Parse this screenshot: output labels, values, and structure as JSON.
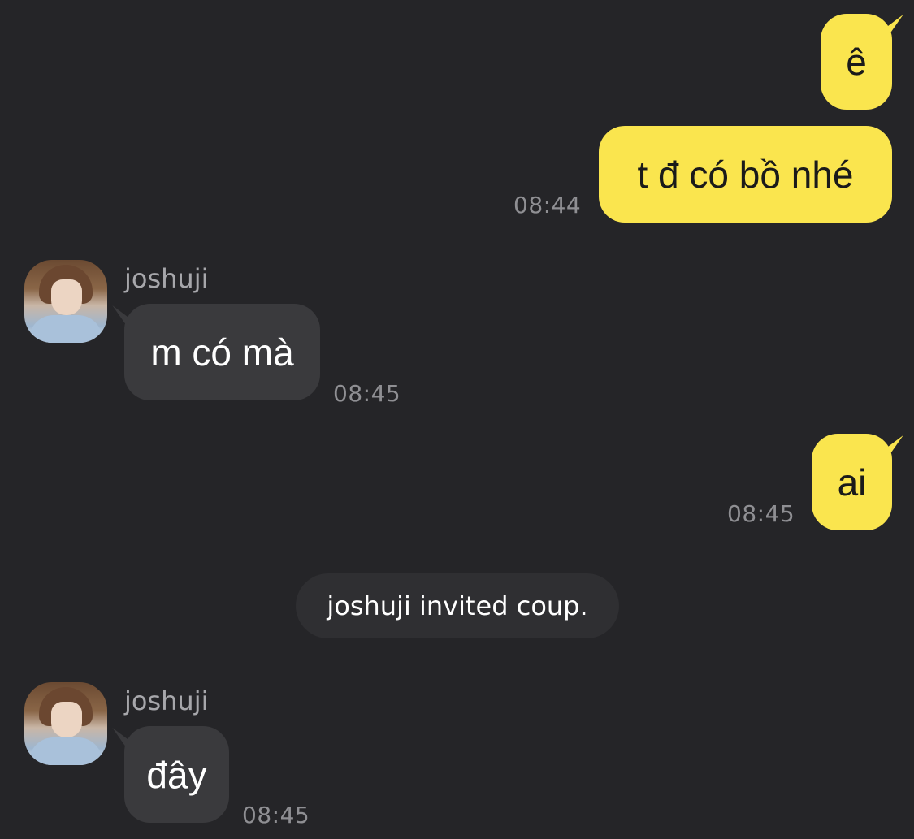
{
  "messages": [
    {
      "direction": "out",
      "text": "ê"
    },
    {
      "direction": "out",
      "text": "t đ có bồ nhé",
      "time": "08:44"
    },
    {
      "direction": "in",
      "sender": "joshuji",
      "text": "m có mà",
      "time": "08:45"
    },
    {
      "direction": "out",
      "text": "ai",
      "time": "08:45"
    },
    {
      "direction": "system",
      "text": "joshuji invited coup."
    },
    {
      "direction": "in",
      "sender": "joshuji",
      "text": "đây",
      "time": "08:45"
    }
  ],
  "colors": {
    "background": "#252528",
    "outgoing_bubble": "#fae54e",
    "incoming_bubble": "#3a3a3d",
    "timestamp": "#8f8f93"
  }
}
